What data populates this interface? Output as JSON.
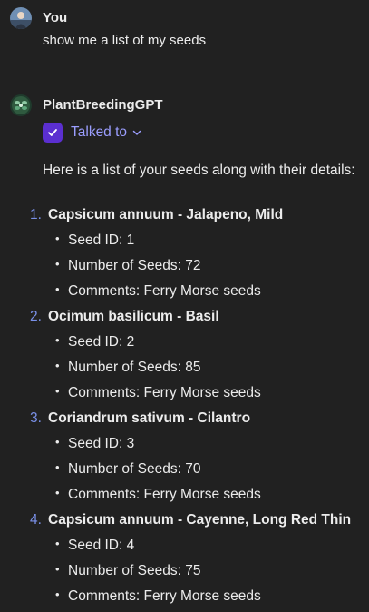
{
  "user_message": {
    "author": "You",
    "text": "show me a list of my seeds"
  },
  "assistant_message": {
    "author": "PlantBreedingGPT",
    "tool_status": "Talked to",
    "intro": "Here is a list of your seeds along with their details:",
    "seeds": [
      {
        "number": "1.",
        "name": "Capsicum annuum - Jalapeno, Mild",
        "details": [
          "Seed ID: 1",
          "Number of Seeds: 72",
          "Comments: Ferry Morse seeds"
        ]
      },
      {
        "number": "2.",
        "name": "Ocimum basilicum - Basil",
        "details": [
          "Seed ID: 2",
          "Number of Seeds: 85",
          "Comments: Ferry Morse seeds"
        ]
      },
      {
        "number": "3.",
        "name": "Coriandrum sativum - Cilantro",
        "details": [
          "Seed ID: 3",
          "Number of Seeds: 70",
          "Comments: Ferry Morse seeds"
        ]
      },
      {
        "number": "4.",
        "name": "Capsicum annuum - Cayenne, Long Red Thin",
        "details": [
          "Seed ID: 4",
          "Number of Seeds: 75",
          "Comments: Ferry Morse seeds"
        ]
      }
    ]
  },
  "icons": {
    "user_avatar": "user-avatar-icon",
    "gpt_avatar": "plant-gpt-avatar-icon",
    "tool_check": "check-icon",
    "expand": "chevron-down-icon"
  },
  "colors": {
    "background": "#212121",
    "text": "#ececec",
    "accent_link": "#9b9eff",
    "list_number": "#7a90e8",
    "check_badge": "#5b2fd0"
  }
}
